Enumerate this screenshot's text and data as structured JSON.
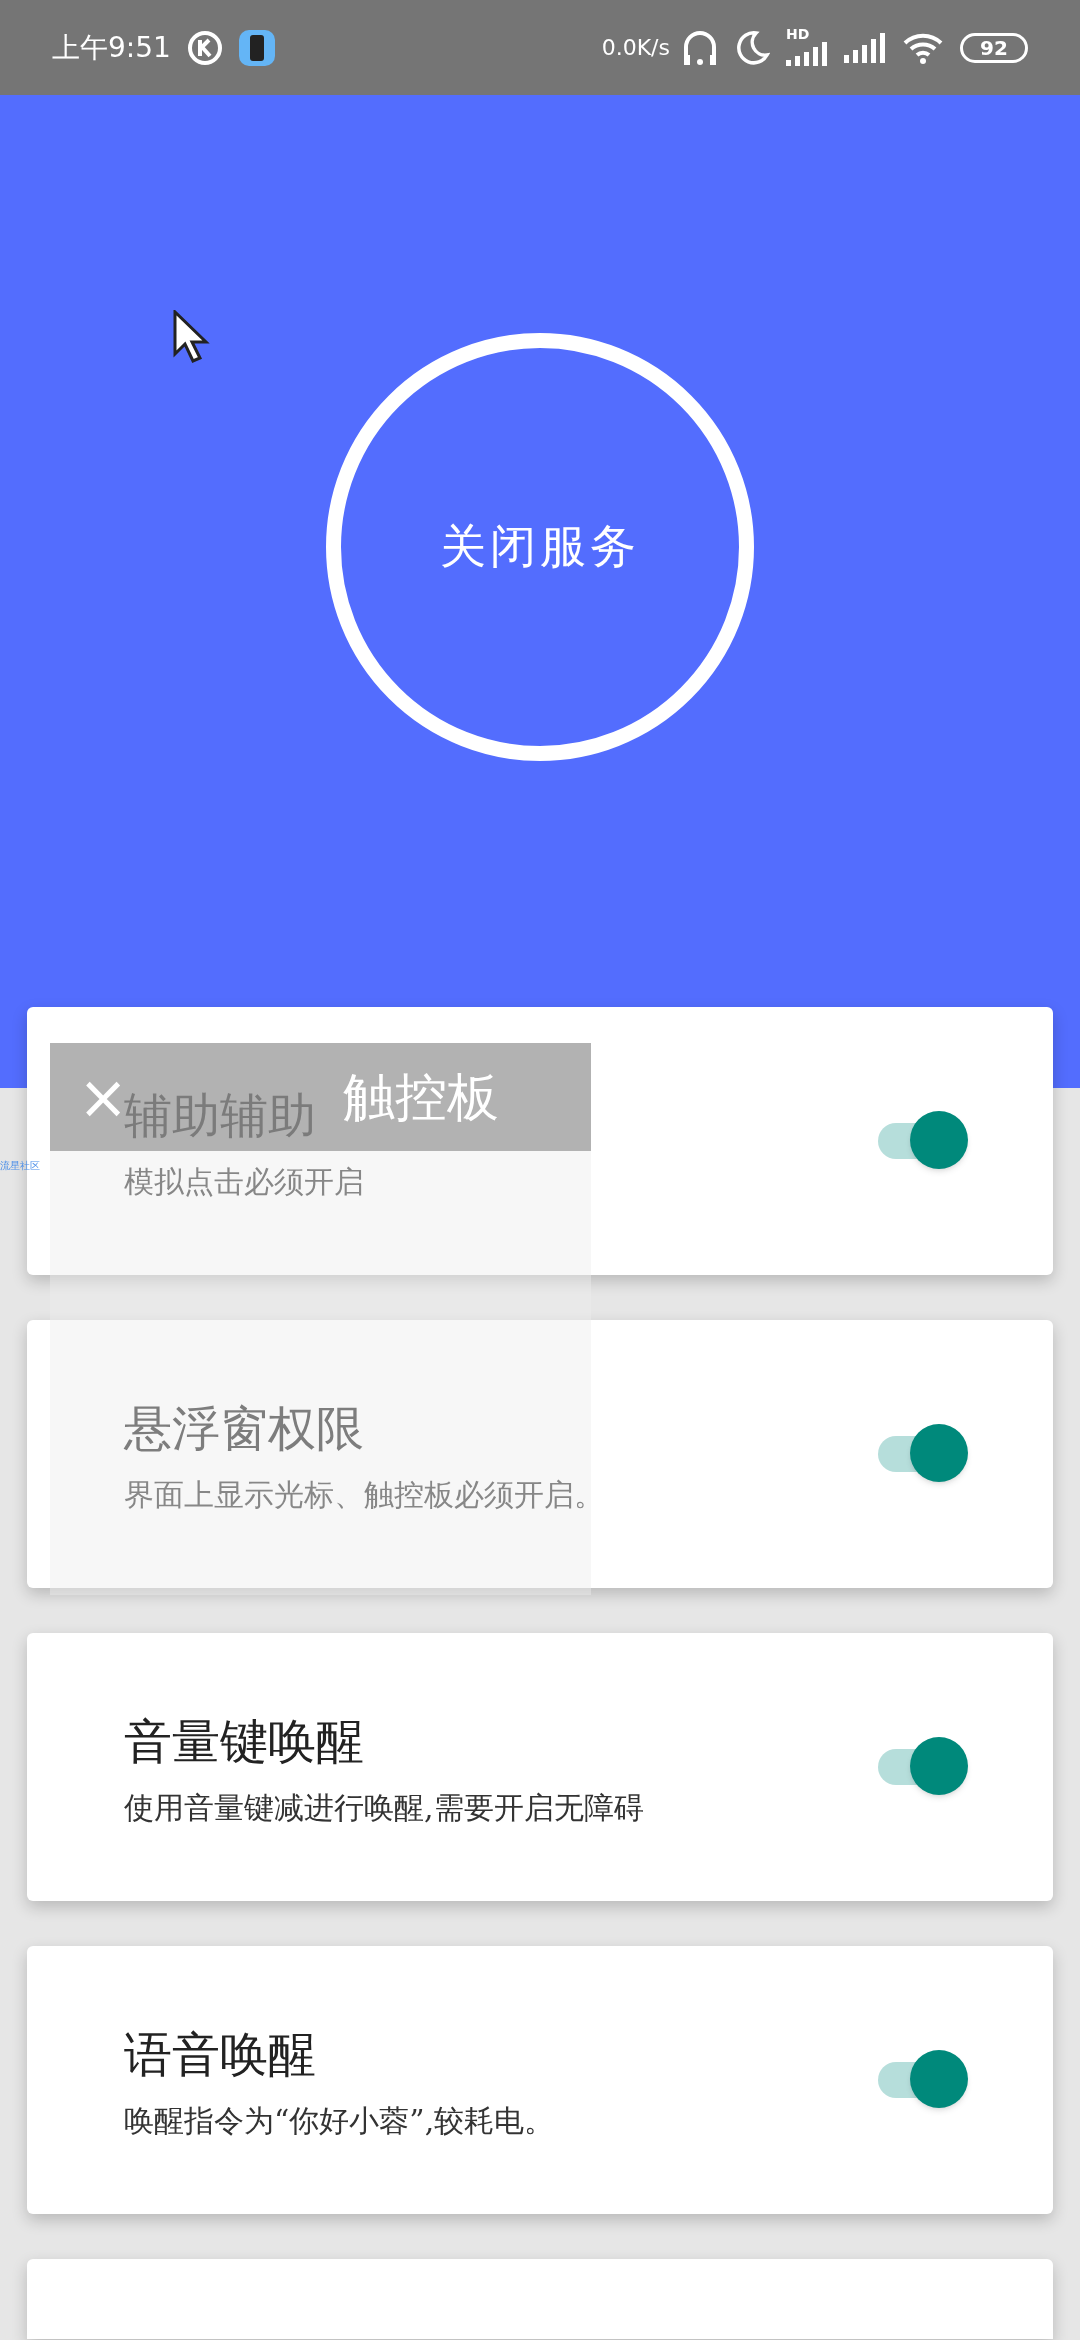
{
  "status_bar": {
    "time": "上午9:51",
    "speed": "0.0K/s",
    "signal_label": "HD",
    "battery": "92"
  },
  "service_button": {
    "label": "关闭服务"
  },
  "cards": [
    {
      "title": "辅助辅助",
      "subtitle": "模拟点击必须开启",
      "on": true
    },
    {
      "title": "悬浮窗权限",
      "subtitle": "界面上显示光标、触控板必须开启。",
      "on": true
    },
    {
      "title": "音量键唤醒",
      "subtitle": "使用音量键减进行唤醒,需要开启无障碍",
      "on": true
    },
    {
      "title": "语音唤醒",
      "subtitle": "唤醒指令为“你好小蓉”,较耗电。",
      "on": true
    }
  ],
  "touchpad_overlay": {
    "title": "触控板",
    "close": "×"
  },
  "edge_label": "流星社区"
}
